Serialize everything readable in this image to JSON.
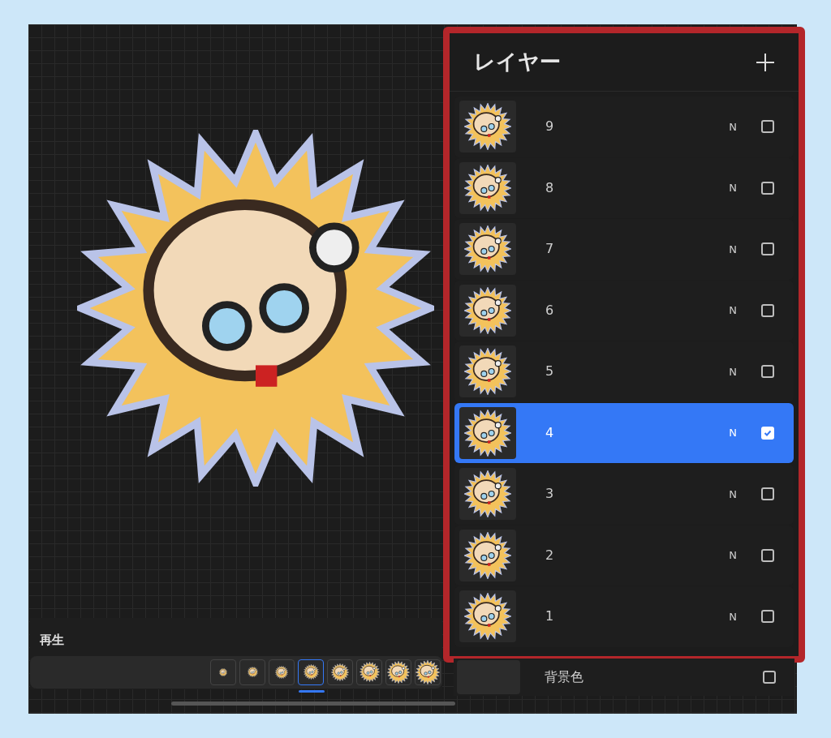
{
  "layers_panel": {
    "title": "レイヤー",
    "layers": [
      {
        "name": "9",
        "blend": "N",
        "checked": false,
        "selected": false
      },
      {
        "name": "8",
        "blend": "N",
        "checked": false,
        "selected": false
      },
      {
        "name": "7",
        "blend": "N",
        "checked": false,
        "selected": false
      },
      {
        "name": "6",
        "blend": "N",
        "checked": false,
        "selected": false
      },
      {
        "name": "5",
        "blend": "N",
        "checked": false,
        "selected": false
      },
      {
        "name": "4",
        "blend": "N",
        "checked": true,
        "selected": true
      },
      {
        "name": "3",
        "blend": "N",
        "checked": false,
        "selected": false
      },
      {
        "name": "2",
        "blend": "N",
        "checked": false,
        "selected": false
      },
      {
        "name": "1",
        "blend": "N",
        "checked": false,
        "selected": false
      }
    ],
    "background": {
      "name": "背景色",
      "checked": false
    }
  },
  "timeline": {
    "title": "再生",
    "frames": [
      {
        "selected": false
      },
      {
        "selected": false
      },
      {
        "selected": false
      },
      {
        "selected": true
      },
      {
        "selected": false
      },
      {
        "selected": false
      },
      {
        "selected": false
      },
      {
        "selected": false
      }
    ]
  }
}
